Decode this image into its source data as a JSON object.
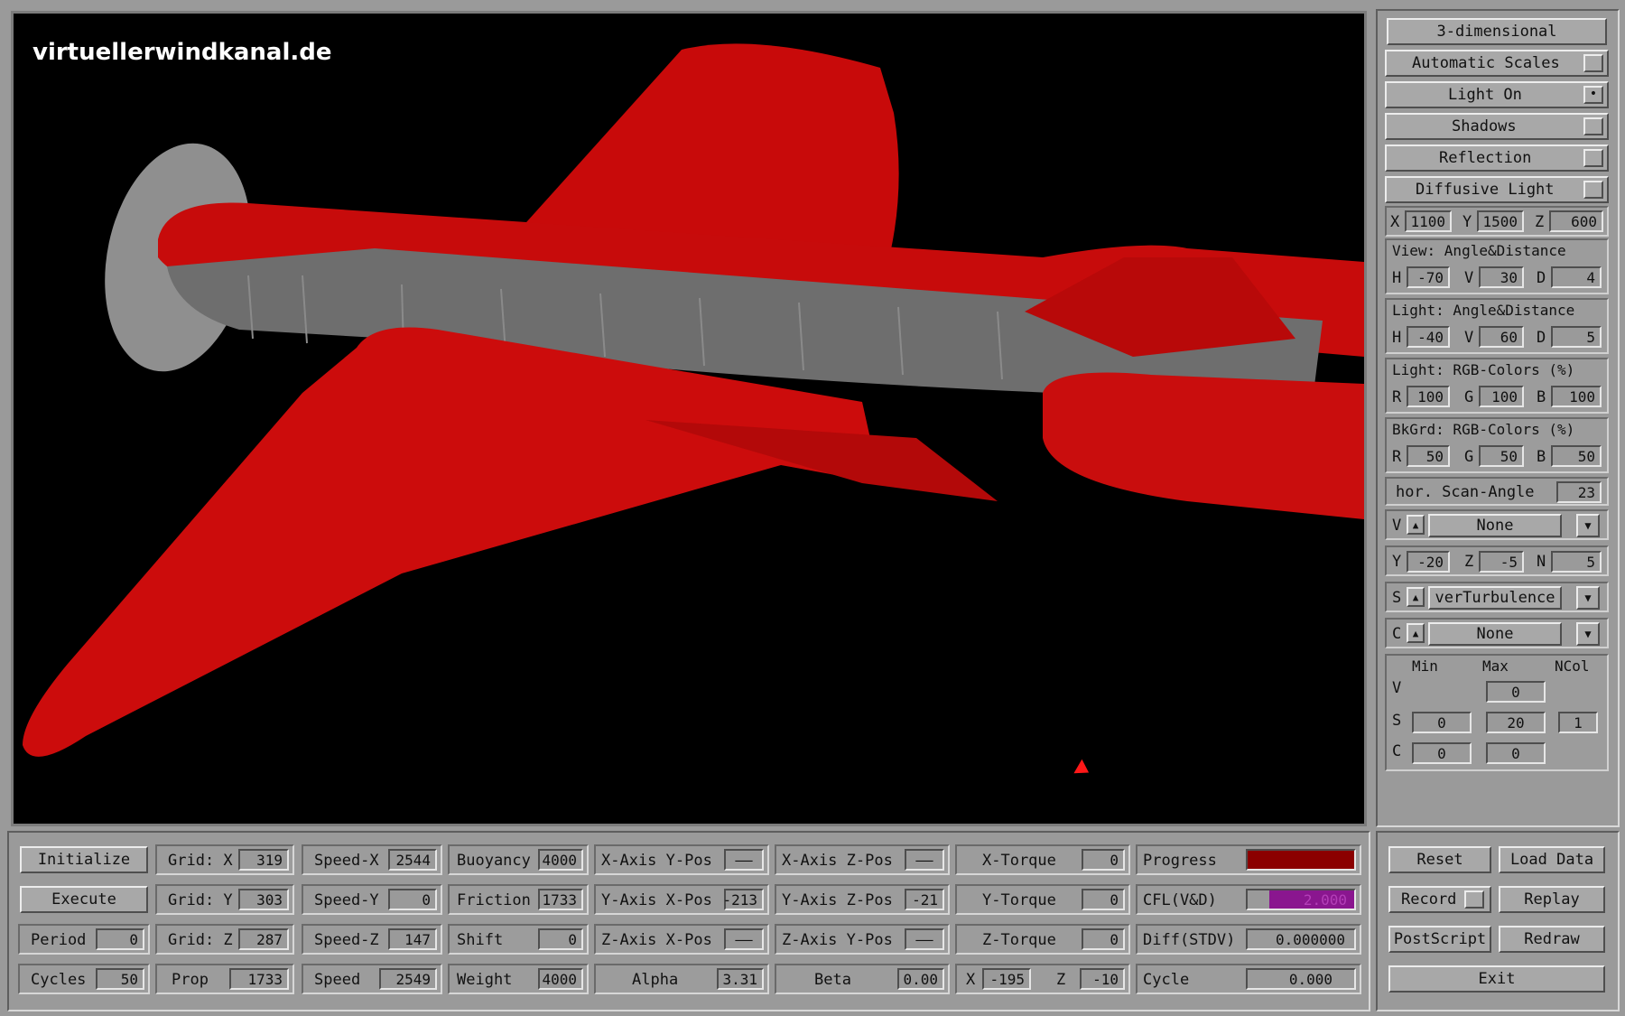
{
  "watermark": "virtuellerwindkanal.de",
  "colors": {
    "model": "#cc0c0c",
    "wing_gray": "#6f6f6f",
    "progress": "#8b0000",
    "cfl": "#8a168f"
  },
  "side": {
    "mode_button": "3-dimensional",
    "toggles": [
      {
        "label": "Automatic Scales",
        "checked": false
      },
      {
        "label": "Light On",
        "checked": true
      },
      {
        "label": "Shadows",
        "checked": false
      },
      {
        "label": "Reflection",
        "checked": false
      },
      {
        "label": "Diffusive Light",
        "checked": false
      }
    ],
    "xyz": {
      "x_label": "X",
      "x": "1100",
      "y_label": "Y",
      "y": "1500",
      "z_label": "Z",
      "z": "600"
    },
    "view": {
      "title": "View:  Angle&Distance",
      "h_label": "H",
      "h": "-70",
      "v_label": "V",
      "v": "30",
      "d_label": "D",
      "d": "4"
    },
    "light": {
      "title": "Light: Angle&Distance",
      "h_label": "H",
      "h": "-40",
      "v_label": "V",
      "v": "60",
      "d_label": "D",
      "d": "5"
    },
    "light_rgb": {
      "title": "Light: RGB-Colors (%)",
      "r_label": "R",
      "r": "100",
      "g_label": "G",
      "g": "100",
      "b_label": "B",
      "b": "100"
    },
    "bkgrd_rgb": {
      "title": "BkGrd: RGB-Colors (%)",
      "r_label": "R",
      "r": "50",
      "g_label": "G",
      "g": "50",
      "b_label": "B",
      "b": "50"
    },
    "scan": {
      "label": "hor. Scan-Angle",
      "value": "23"
    },
    "v_select": {
      "letter": "V",
      "value": "None"
    },
    "yzn": {
      "y_label": "Y",
      "y": "-20",
      "z_label": "Z",
      "z": "-5",
      "n_label": "N",
      "n": "5"
    },
    "s_select": {
      "letter": "S",
      "value": "verTurbulence"
    },
    "c_select": {
      "letter": "C",
      "value": "None"
    },
    "ranges": {
      "min_label": "Min",
      "max_label": "Max",
      "ncol_label": "NCol",
      "v_label": "V",
      "v_max": "0",
      "s_label": "S",
      "s_min": "0",
      "s_max": "20",
      "s_ncol": "1",
      "c_label": "C",
      "c_min": "0",
      "c_max": "0"
    }
  },
  "bottom": {
    "initialize": "Initialize",
    "execute": "Execute",
    "period_label": "Period",
    "period": "0",
    "cycles_label": "Cycles",
    "cycles": "50",
    "gridx_label": "Grid: X",
    "gridx": "319",
    "gridy_label": "Grid: Y",
    "gridy": "303",
    "gridz_label": "Grid: Z",
    "gridz": "287",
    "prop_label": "Prop",
    "prop": "1733",
    "speedx_label": "Speed-X",
    "speedx": "2544",
    "speedy_label": "Speed-Y",
    "speedy": "0",
    "speedz_label": "Speed-Z",
    "speedz": "147",
    "speed_label": "Speed",
    "speed": "2549",
    "buoyancy_label": "Buoyancy",
    "buoyancy": "4000",
    "friction_label": "Friction",
    "friction": "1733",
    "shift_label": "Shift",
    "shift": "0",
    "weight_label": "Weight",
    "weight": "4000",
    "xaxis_ypos_label": "X-Axis Y-Pos",
    "xaxis_ypos": "——",
    "yaxis_xpos_label": "Y-Axis X-Pos",
    "yaxis_xpos": "-213",
    "zaxis_xpos_label": "Z-Axis X-Pos",
    "zaxis_xpos": "——",
    "alpha_label": "Alpha",
    "alpha": "3.31",
    "xaxis_zpos_label": "X-Axis Z-Pos",
    "xaxis_zpos": "——",
    "yaxis_zpos_label": "Y-Axis Z-Pos",
    "yaxis_zpos": "-21",
    "zaxis_ypos_label": "Z-Axis Y-Pos",
    "zaxis_ypos": "——",
    "beta_label": "Beta",
    "beta": "0.00",
    "xtorque_label": "X-Torque",
    "xtorque": "0",
    "ytorque_label": "Y-Torque",
    "ytorque": "0",
    "ztorque_label": "Z-Torque",
    "ztorque": "0",
    "x_label": "X",
    "x": "-195",
    "z_label": "Z",
    "z": "-10",
    "progress_label": "Progress",
    "cfl_label": "CFL(V&D)",
    "cfl": "2.000",
    "diff_label": "Diff(STDV)",
    "diff": "0.000000",
    "cycle_label": "Cycle",
    "cycle": "0.000",
    "reset": "Reset",
    "load_data": "Load Data",
    "record": "Record",
    "replay": "Replay",
    "postscript": "PostScript",
    "redraw": "Redraw",
    "exit": "Exit"
  }
}
